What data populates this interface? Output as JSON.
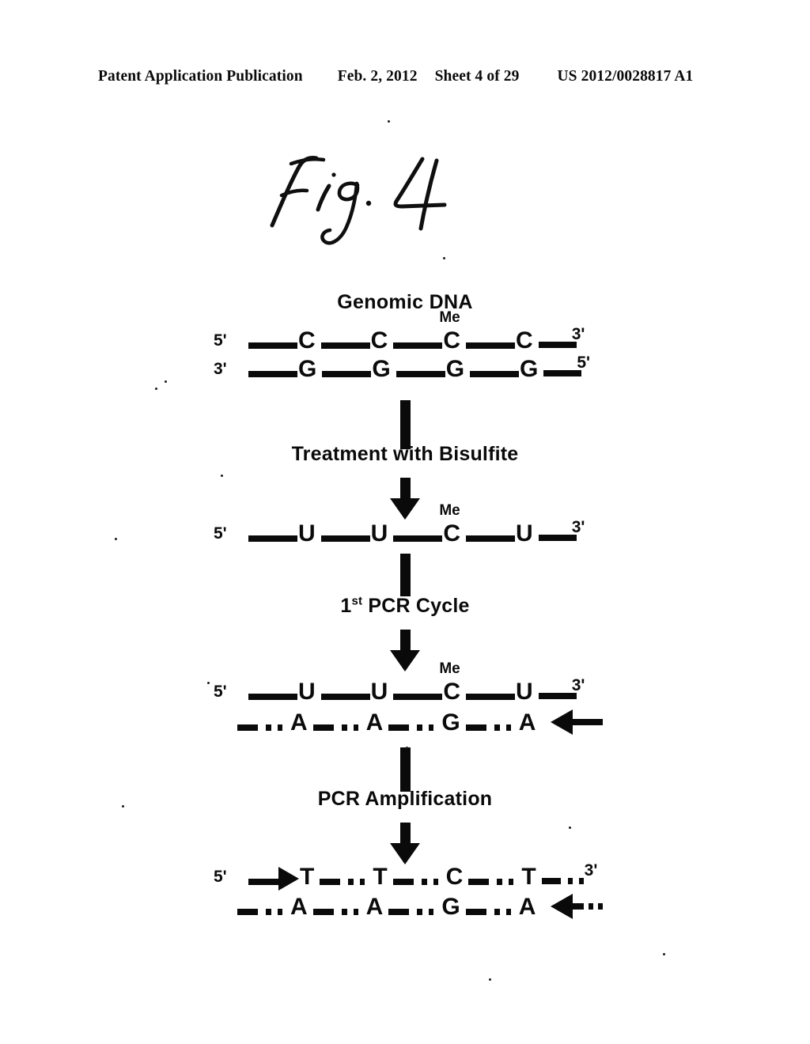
{
  "header": {
    "publication": "Patent Application Publication",
    "date": "Feb. 2, 2012",
    "sheet": "Sheet 4 of 29",
    "document_number": "US 2012/0028817 A1"
  },
  "figure": {
    "label": "Fig. 4",
    "label_style": "handwritten"
  },
  "diagram": {
    "title": "Genomic DNA",
    "steps": [
      {
        "label": "Treatment with Bisulfite"
      },
      {
        "label_prefix": "1",
        "label_sup": "st",
        "label_suffix": " PCR Cycle",
        "label": "1st PCR Cycle"
      },
      {
        "label": "PCR Amplification"
      }
    ],
    "stages": [
      {
        "name": "genomic-dna",
        "top_strand": {
          "left_end": "5'",
          "right_end": "3'",
          "bases": [
            "C",
            "C",
            "C",
            "C"
          ],
          "methylated_index": 2,
          "methyl_label": "Me"
        },
        "bottom_strand": {
          "left_end": "3'",
          "right_end": "5'",
          "bases": [
            "G",
            "G",
            "G",
            "G"
          ]
        }
      },
      {
        "name": "after-bisulfite",
        "top_strand": {
          "left_end": "5'",
          "right_end": "3'",
          "bases": [
            "U",
            "U",
            "C",
            "U"
          ],
          "methylated_index": 2,
          "methyl_label": "Me"
        },
        "bottom_strand": null
      },
      {
        "name": "after-first-pcr-cycle",
        "top_strand": {
          "left_end": "5'",
          "right_end": "3'",
          "bases": [
            "U",
            "U",
            "C",
            "U"
          ],
          "methylated_index": 2,
          "methyl_label": "Me"
        },
        "bottom_strand": {
          "left_end": "",
          "right_end": "",
          "bases": [
            "A",
            "A",
            "G",
            "A"
          ],
          "primer_arrow": "left"
        }
      },
      {
        "name": "after-pcr-amplification",
        "top_strand": {
          "left_end": "5'",
          "right_end": "3'",
          "bases": [
            "T",
            "T",
            "C",
            "T"
          ],
          "primer_arrow": "right"
        },
        "bottom_strand": {
          "left_end": "",
          "right_end": "",
          "bases": [
            "A",
            "A",
            "G",
            "A"
          ],
          "primer_arrow": "left"
        }
      }
    ]
  },
  "colors": {
    "ink": "#0a0a0a",
    "page": "#ffffff"
  }
}
